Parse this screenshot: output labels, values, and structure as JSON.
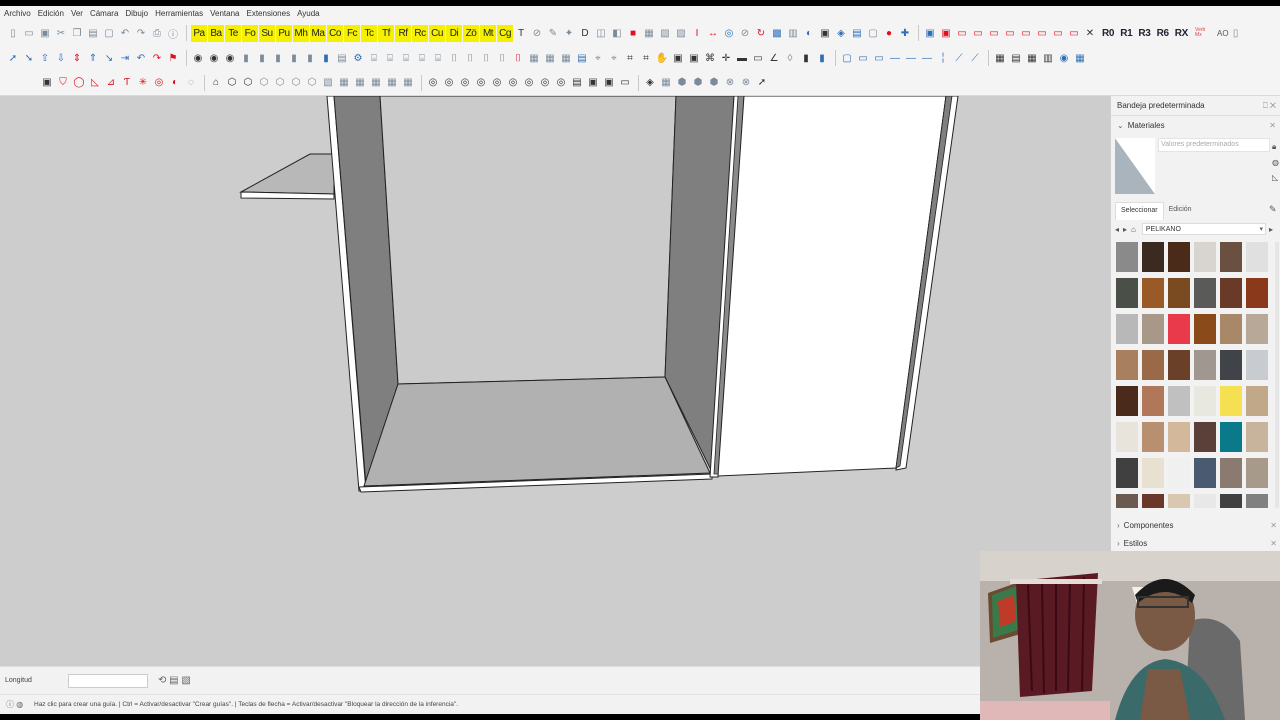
{
  "menu": {
    "items": [
      "Archivo",
      "Edición",
      "Ver",
      "Cámara",
      "Dibujo",
      "Herramientas",
      "Ventana",
      "Extensiones",
      "Ayuda"
    ]
  },
  "toolbar1": {
    "yellow_buttons": [
      "Pa",
      "Ba",
      "Te",
      "Fo",
      "Su",
      "Pu",
      "Mh",
      "Ma",
      "Co",
      "Fc",
      "Tc",
      "Tf",
      "Rf",
      "Rc",
      "Cu",
      "Di",
      "Zö",
      "Mt",
      "Cg"
    ],
    "rotate_buttons": [
      "R0",
      "R1",
      "R3",
      "R6",
      "RX"
    ],
    "extra_label": "Verb Mx",
    "ao_label": "AO"
  },
  "tray": {
    "title": "Bandeja predeterminada",
    "materials_section": "Materiales",
    "material_name_placeholder": "Valores predeterminados",
    "tab_select": "Seleccionar",
    "tab_edit": "Edición",
    "library_name": "PELIKANO",
    "components_section": "Componentes",
    "styles_section": "Estilos"
  },
  "swatch_colors": [
    "#8a8a8a",
    "#3a2a20",
    "#4a2a18",
    "#d8d4d0",
    "#6a5040",
    "#e0e0e0",
    "#4a5048",
    "#9a5a28",
    "#7a4a20",
    "#5a5a58",
    "#6a3a28",
    "#8a3a1a",
    "#b8b8b8",
    "#a89888",
    "#e83a4a",
    "#8a4a1a",
    "#a88868",
    "#b8a898",
    "#a88060",
    "#9a6a48",
    "#6a4028",
    "#a09890",
    "#404448",
    "#c8ccd0",
    "#4a2a1a",
    "#b07858",
    "#c0c0c0",
    "#e8e8e0",
    "#f4e050",
    "#c0a888",
    "#e8e4dc",
    "#b89070",
    "#d4b89c",
    "#5a4038",
    "#0a7a8a",
    "#c8b49c",
    "#404040",
    "#e8e0d0",
    "#f0f0f0",
    "#4a5a70",
    "#8a7a70",
    "#a89a8a",
    "#6a5a50",
    "#6a3828",
    "#d8c8b0",
    "#e8e8e8",
    "#404040",
    "#808080"
  ],
  "vcb": {
    "label": "Longitud",
    "value": ""
  },
  "status": {
    "text": "Haz clic para crear una guía. | Ctrl = Activar/desactivar \"Crear guías\". | Teclas de flecha = Activar/desactivar \"Bloquear la dirección de la inferencia\"."
  },
  "colors": {
    "viewport_bg": "#cdcdcd",
    "panel_dark": "#7f7f7f",
    "panel_light": "#b1b1b1",
    "door_white": "#ffffff",
    "yellow_button": "#f4f000"
  }
}
